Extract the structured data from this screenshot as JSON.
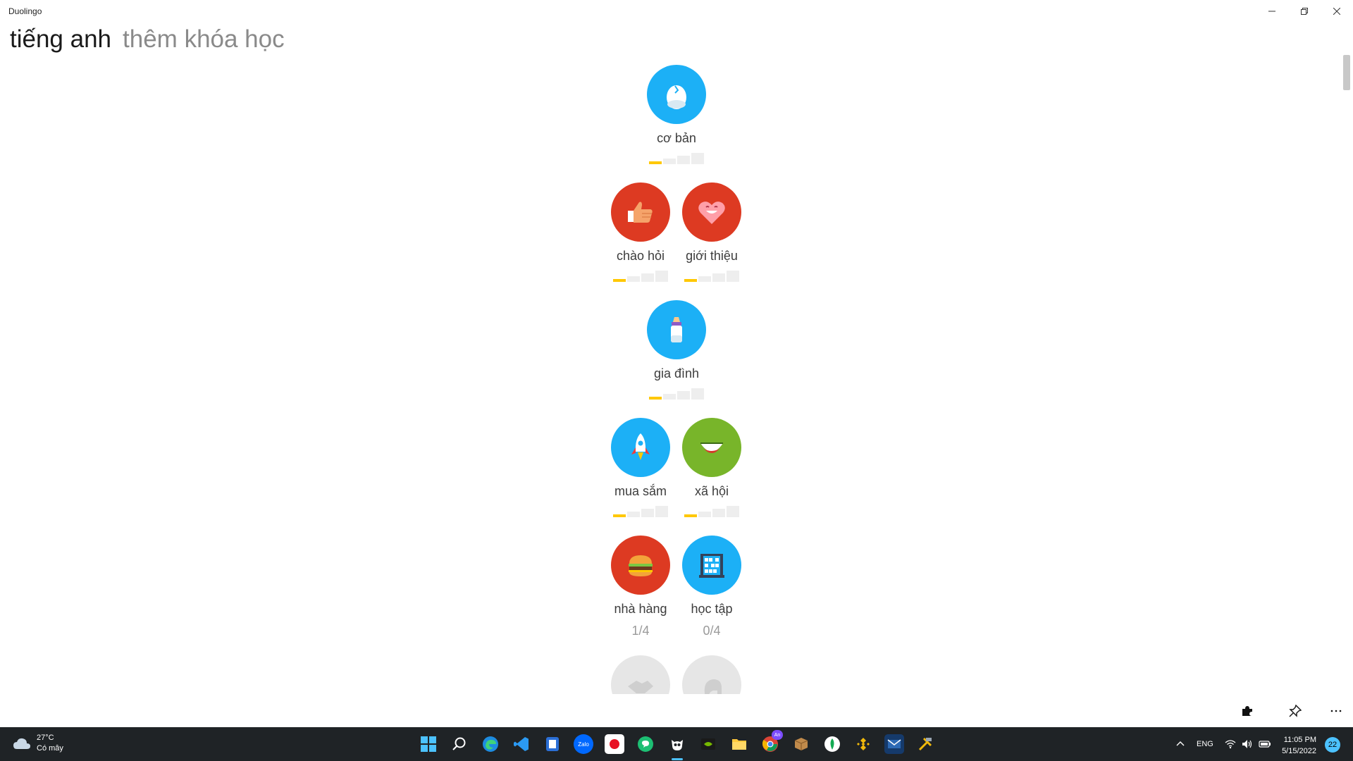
{
  "window": {
    "title": "Duolingo"
  },
  "header": {
    "active_tab": "tiếng anh",
    "add_course": "thêm khóa học"
  },
  "skills": [
    {
      "label": "cơ bản",
      "color": "#1cb0f6",
      "icon": "egg-icon",
      "strength": 1
    },
    {
      "label": "chào hỏi",
      "color": "#dd3a22",
      "icon": "thumbs-up-icon",
      "strength": 1
    },
    {
      "label": "giới thiệu",
      "color": "#dd3a22",
      "icon": "heart-face-icon",
      "strength": 1
    },
    {
      "label": "gia đình",
      "color": "#1cb0f6",
      "icon": "baby-bottle-icon",
      "strength": 1
    },
    {
      "label": "mua sắm",
      "color": "#1cb0f6",
      "icon": "rocket-icon",
      "strength": 1
    },
    {
      "label": "xã hội",
      "color": "#78b52a",
      "icon": "smile-face-icon",
      "strength": 1
    },
    {
      "label": "nhà hàng",
      "color": "#dd3a22",
      "icon": "burger-icon",
      "progress": "1/4"
    },
    {
      "label": "học tập",
      "color": "#1cb0f6",
      "icon": "abacus-icon",
      "progress": "0/4"
    },
    {
      "label": "",
      "color": "#e6e6e6",
      "icon": "locked-handshake-icon"
    },
    {
      "label": "",
      "color": "#e6e6e6",
      "icon": "locked-elephant-icon"
    }
  ],
  "taskbar": {
    "weather_temp": "27°C",
    "weather_desc": "Có mây",
    "language": "ENG",
    "time": "11:05 PM",
    "date": "5/15/2022",
    "notifications": "22",
    "chrome_badge": "An",
    "zalo": "Zalo"
  },
  "colors": {
    "accent_blue": "#1cb0f6",
    "accent_red": "#dd3a22",
    "accent_green": "#78b52a",
    "gold": "#ffc800"
  }
}
